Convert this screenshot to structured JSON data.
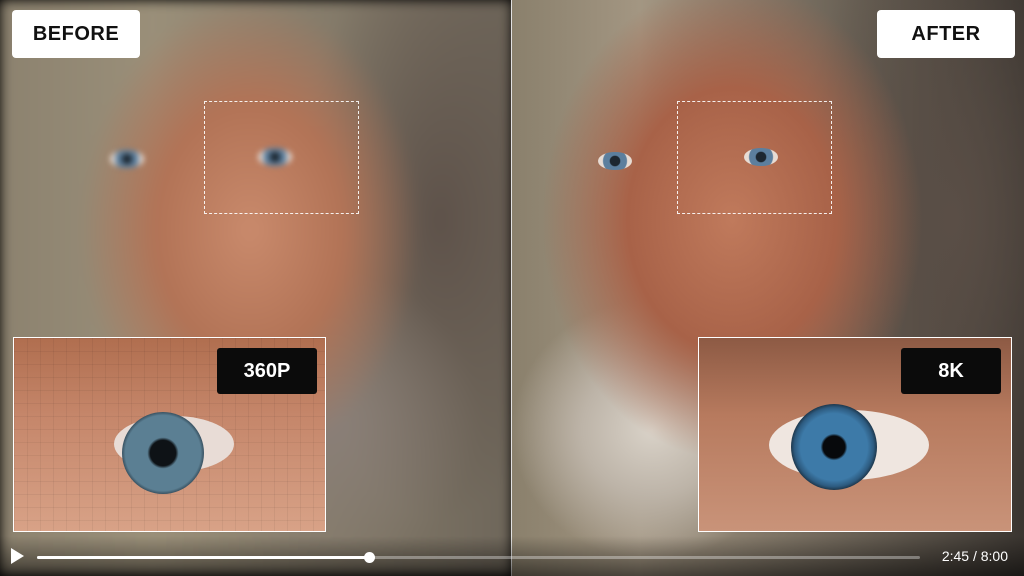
{
  "labels": {
    "before": "BEFORE",
    "after": "AFTER"
  },
  "badges": {
    "low": "360P",
    "high": "8K"
  },
  "player": {
    "time_display": "2:45 / 8:00",
    "progress": 0.376,
    "play_icon": "play-icon"
  },
  "colors": {
    "accent": "#ffffff",
    "badge_bg": "#0b0b0b"
  }
}
